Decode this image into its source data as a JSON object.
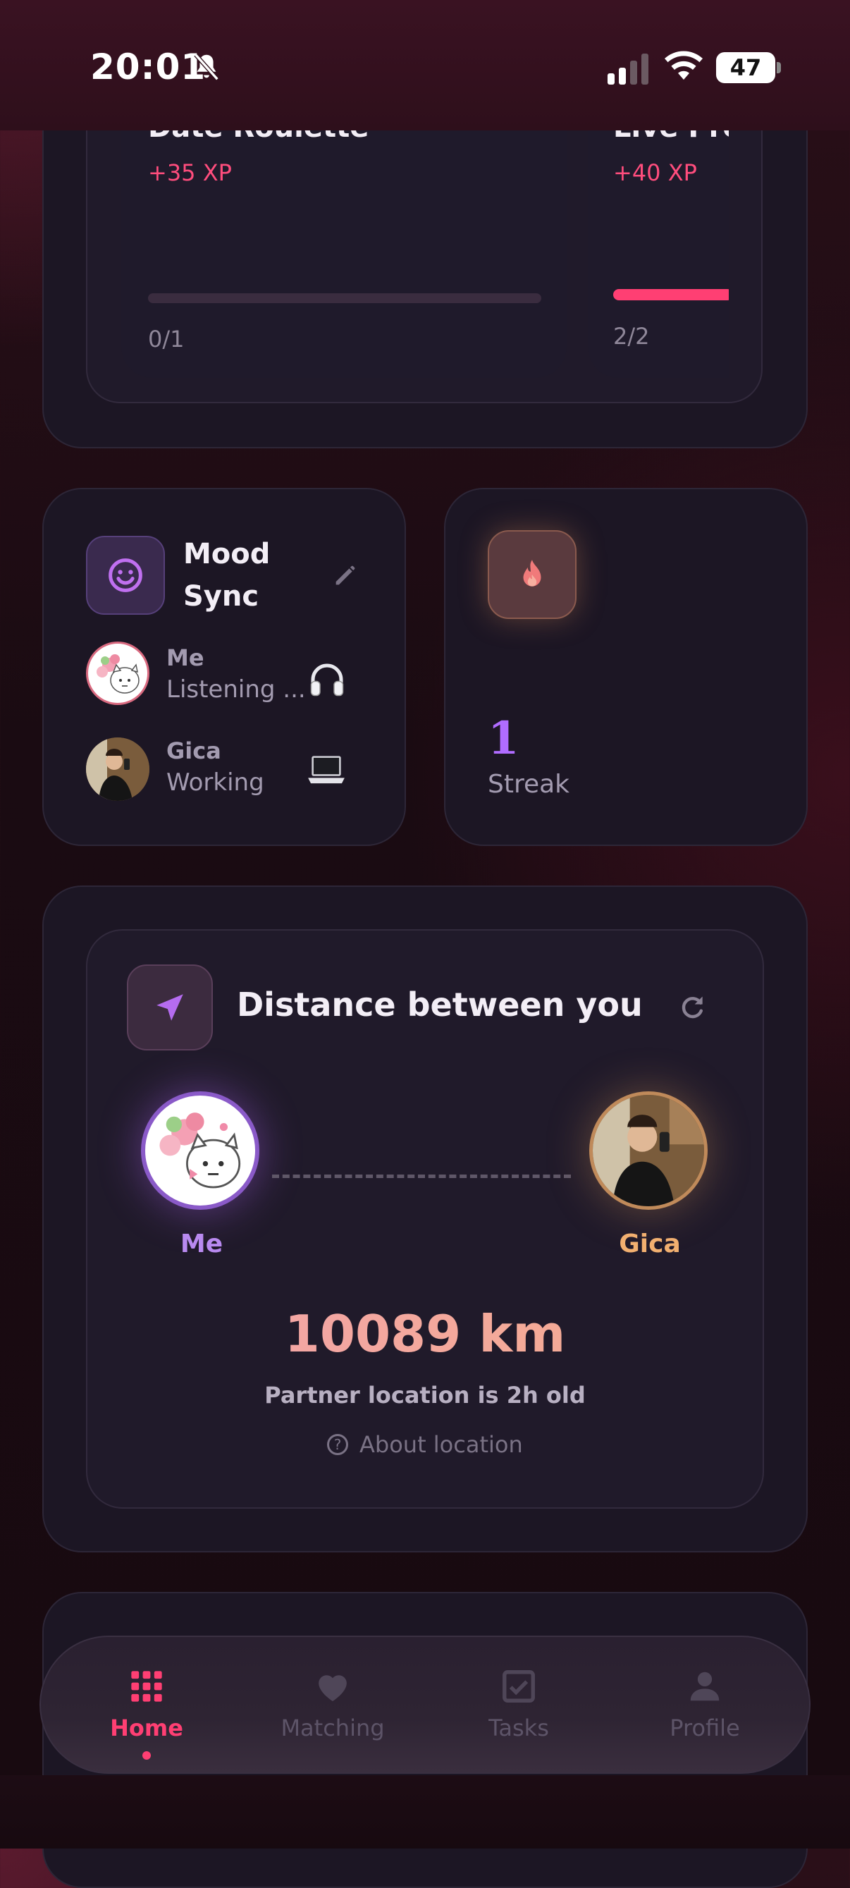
{
  "status_bar": {
    "time": "20:01",
    "battery": "47"
  },
  "challenges": [
    {
      "title": "Date Roulette",
      "xp": "+35 XP",
      "count": "0/1",
      "progress": 0.0
    },
    {
      "title": "Live Pre",
      "xp": "+40 XP",
      "count": "2/2",
      "progress": 1.0
    }
  ],
  "mood": {
    "title_line1": "Mood",
    "title_line2": "Sync",
    "entries": [
      {
        "name": "Me",
        "status": "Listening ...",
        "icon": "headphones-icon"
      },
      {
        "name": "Gica",
        "status": "Working",
        "icon": "laptop-icon"
      }
    ]
  },
  "streak": {
    "value": "1",
    "label": "Streak"
  },
  "distance": {
    "title": "Distance between you",
    "me_label": "Me",
    "partner_label": "Gica",
    "value": "10089 km",
    "location_age": "Partner location is 2h old",
    "about": "About location"
  },
  "tabs": [
    {
      "label": "Home",
      "icon": "grid-icon",
      "active": true
    },
    {
      "label": "Matching",
      "icon": "heart-icon",
      "active": false
    },
    {
      "label": "Tasks",
      "icon": "checkbox-icon",
      "active": false
    },
    {
      "label": "Profile",
      "icon": "person-icon",
      "active": false
    }
  ],
  "colors": {
    "accent": "#ff3f73",
    "purple": "#b06cff",
    "gold": "#f5b06a"
  }
}
